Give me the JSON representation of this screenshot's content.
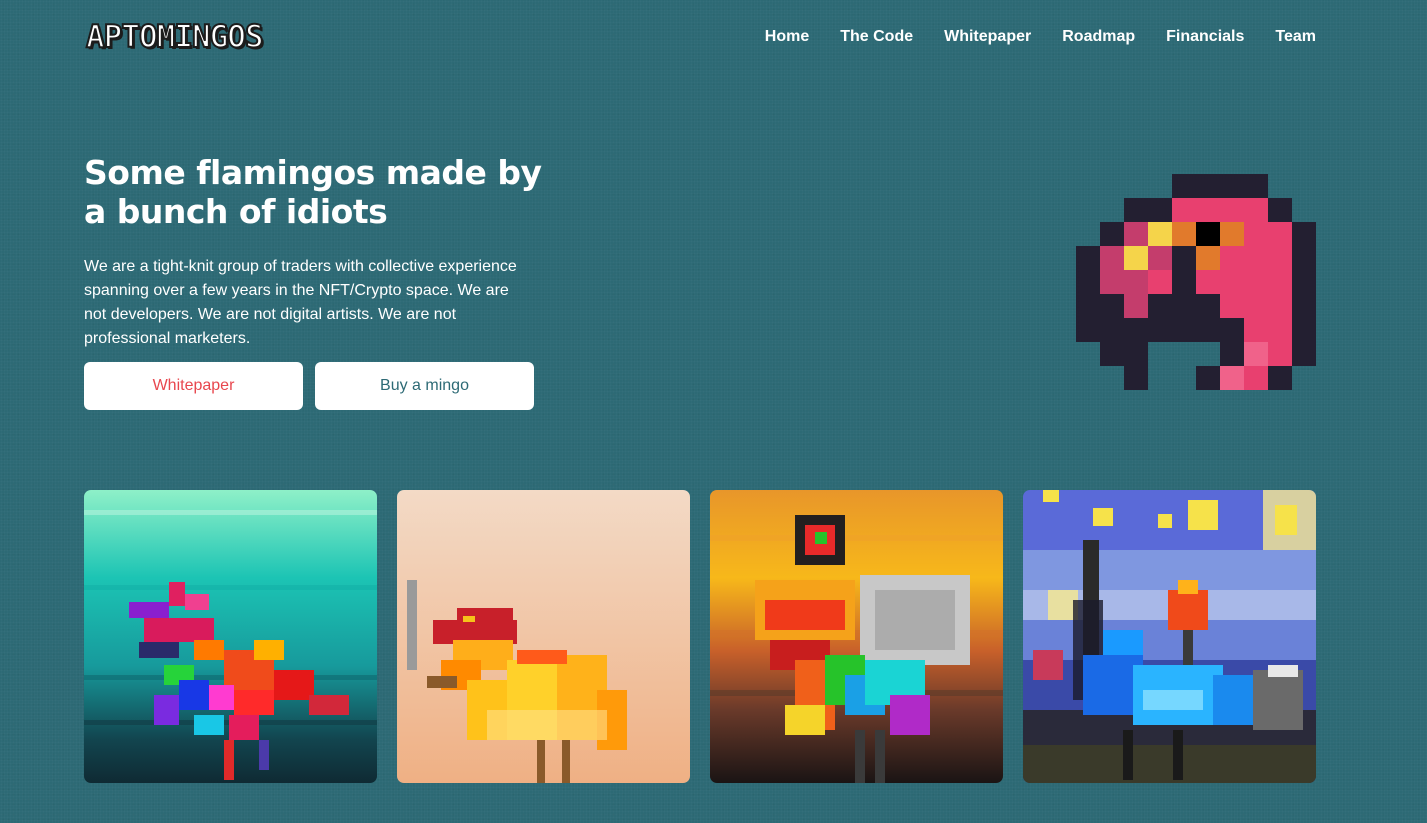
{
  "brand": {
    "logo_text": "APTOMINGOS"
  },
  "nav": {
    "items": [
      {
        "label": "Home"
      },
      {
        "label": "The Code"
      },
      {
        "label": "Whitepaper"
      },
      {
        "label": "Roadmap"
      },
      {
        "label": "Financials"
      },
      {
        "label": "Team"
      }
    ]
  },
  "hero": {
    "title": "Some flamingos made by a bunch of idiots",
    "description": "We are a tight-knit group of traders with collective experience spanning over a few years in the NFT/Crypto space. We are not developers. We are not digital artists. We are not professional marketers.",
    "primary_button": "Whitepaper",
    "secondary_button": "Buy a mingo"
  },
  "colors": {
    "background": "#2d6a75",
    "text": "#ffffff",
    "primary_button_text": "#e8474e",
    "secondary_button_text": "#2d6a75",
    "mascot_outline": "#231f31",
    "mascot_pink": "#e8406f"
  },
  "gallery": {
    "cards": [
      {
        "icon": "flamingo-nft-teal-art"
      },
      {
        "icon": "flamingo-nft-peach-art"
      },
      {
        "icon": "flamingo-nft-sunset-art"
      },
      {
        "icon": "flamingo-nft-starry-night-art"
      }
    ]
  }
}
